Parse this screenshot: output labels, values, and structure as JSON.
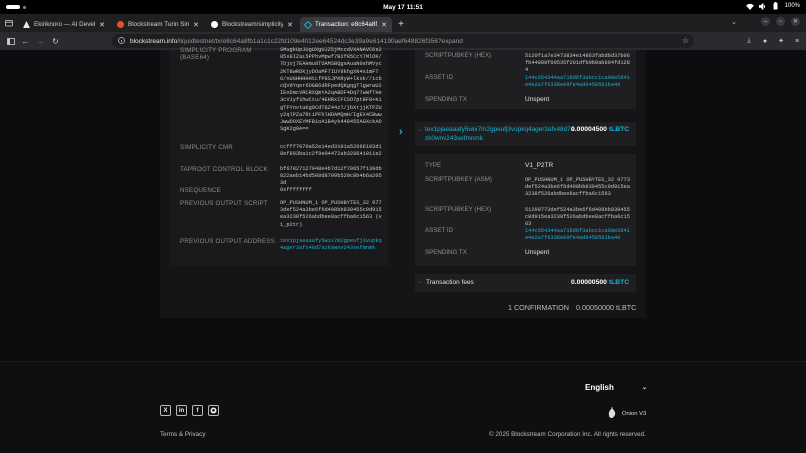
{
  "os": {
    "clock": "May 17  11:51",
    "battery": "100%"
  },
  "tabs": [
    {
      "title": "Ekiriknoro — AI Develope",
      "favicon_color": "#f0f0f0",
      "active": false
    },
    {
      "title": "Blockstream Turin Simpli",
      "favicon_color": "#e0542a",
      "active": false
    },
    {
      "title": "Blockstream/simplicity-c",
      "favicon_color": "#ffffff",
      "active": false
    },
    {
      "title": "Transaction: e8c64a8fb1",
      "favicon_color": "#18b3d6",
      "active": true
    }
  ],
  "address_bar": {
    "domain": "blockstream.info",
    "path": "/liquidtestnet/tx/e8c64a8fb1a1c1c22fd109e4012ee64524dc3e39a9e614190aef648826f356?expand"
  },
  "input_details": [
    {
      "label": "SIMPLICITY PROGRAM (BASE64)",
      "value": "SMugkUpJUgUXgUJZ5jMccdVXANAVC6s285s8IZaL5PPhvMpwf7B2f85CcY7MlOK/7Djoj7EAHmu8TOAMSBQgsAuaN0shMVyc2KT8wRDKjyDOaMF7IUY8khgXN4s1mFT6/nUGHHHHHtLfP8SJPKRyW+lkxk//icbcQVdYqer6OGB6dRFpedQKgqgTlgwrwU2IEnDmcVRCRXQmYA2qABDF4Dq77wWfTHe3cV1yf1hwCtu/4EHRxIFCSO7ptBF8+KigTFYnvtuKg9CdT8Z44zl/jbXrjjKTPZUy2qlPZa7RtiPFhlHDAMQmH/IgEX4CBwwJwwDOXEYMFB1oA1B4yk448455AGXckAOSgK2g9A==",
      "link": false
    },
    {
      "label": "SIMPLICITY CMR",
      "value": "ccfff7070a52e14ed3101a52066193d18ef893ba1c2f9e04472ab328641011e2",
      "link": false
    },
    {
      "label": "TAPROOT CONTROL BLOCK",
      "value": "bf67827127948e4b7d12f79657f138db822aeb14bd508d8799b529c8b4b6a2053d",
      "link": false
    },
    {
      "label": "NSEQUENCE",
      "value": "0xffffffff",
      "link": false
    },
    {
      "label": "PREVIOUS OUTPUT SCRIPT",
      "value": "OP_PUSHNUM_1 OP_PUSHBYTES_32 9773def524a3be6f6d408bb839455c0d915ea3238f526abdbee8acffba6c1563 (v1_p2tr)",
      "link": false
    },
    {
      "label": "PREVIOUS OUTPUT ADDRESS",
      "value": "tex1pjaeaaafy5wix7m2gpeufj3vupkq4ager3afx48d7azk0wnv243sefmnmk",
      "link": true
    }
  ],
  "output_top": {
    "scriptpubkey_hex_label": "SCRIPTPUBKEY (HEX)",
    "scriptpubkey_hex": "5120f1a7e3473834e14863fabd6d37b06fb44889f09535f201dfb0b0ab604fd1284",
    "asset_id_label": "ASSET ID",
    "asset_id": "144c654344aa716d6f3abcc1ca00e5641e4e2a7f6338e09fe4ad6450581ba49",
    "spending_tx_label": "SPENDING TX",
    "spending_tx": "Unspent"
  },
  "output_main": {
    "address": "tex1pjaeaaafy5wix7m2gpeufj3vupkq4ager3afx48d7azk0wnv243sefmnmk",
    "amount": "0.00004500",
    "unit": "tLBTC",
    "type_label": "TYPE",
    "type": "V1_P2TR",
    "asm_label": "SCRIPTPUBKEY (ASM)",
    "asm": "OP_PUSHNUM_1 OP_PUSHBYTES_32 9773def524a3be6f6d408bb839455c0d915ea3238f526abdbee8acffba6c1563",
    "hex_label": "SCRIPTPUBKEY (HEX)",
    "hex": "51209773def524a3be6f6d408bb839455c0d915ea3238f526abdbee8acffba6c1563",
    "asset_id_label": "ASSET ID",
    "asset_id": "144c654344aa716d6f3abcc1ca00e5641e4e2a7f6338e09fe4ad6450581ba49",
    "spending_tx_label": "SPENDING TX",
    "spending_tx": "Unspent"
  },
  "fees": {
    "label": "Transaction fees",
    "amount": "0.00000500",
    "unit": "tLBTC"
  },
  "summary": {
    "confirmations": "1 CONFIRMATION",
    "total": "0.00050000 tLBTC"
  },
  "footer": {
    "language": "English",
    "socials": [
      "X",
      "in",
      "f",
      "github"
    ],
    "onion": "Onion V3",
    "terms": "Terms & Privacy",
    "copyright": "© 2025 Blockstream Corporation Inc. All rights reserved."
  }
}
